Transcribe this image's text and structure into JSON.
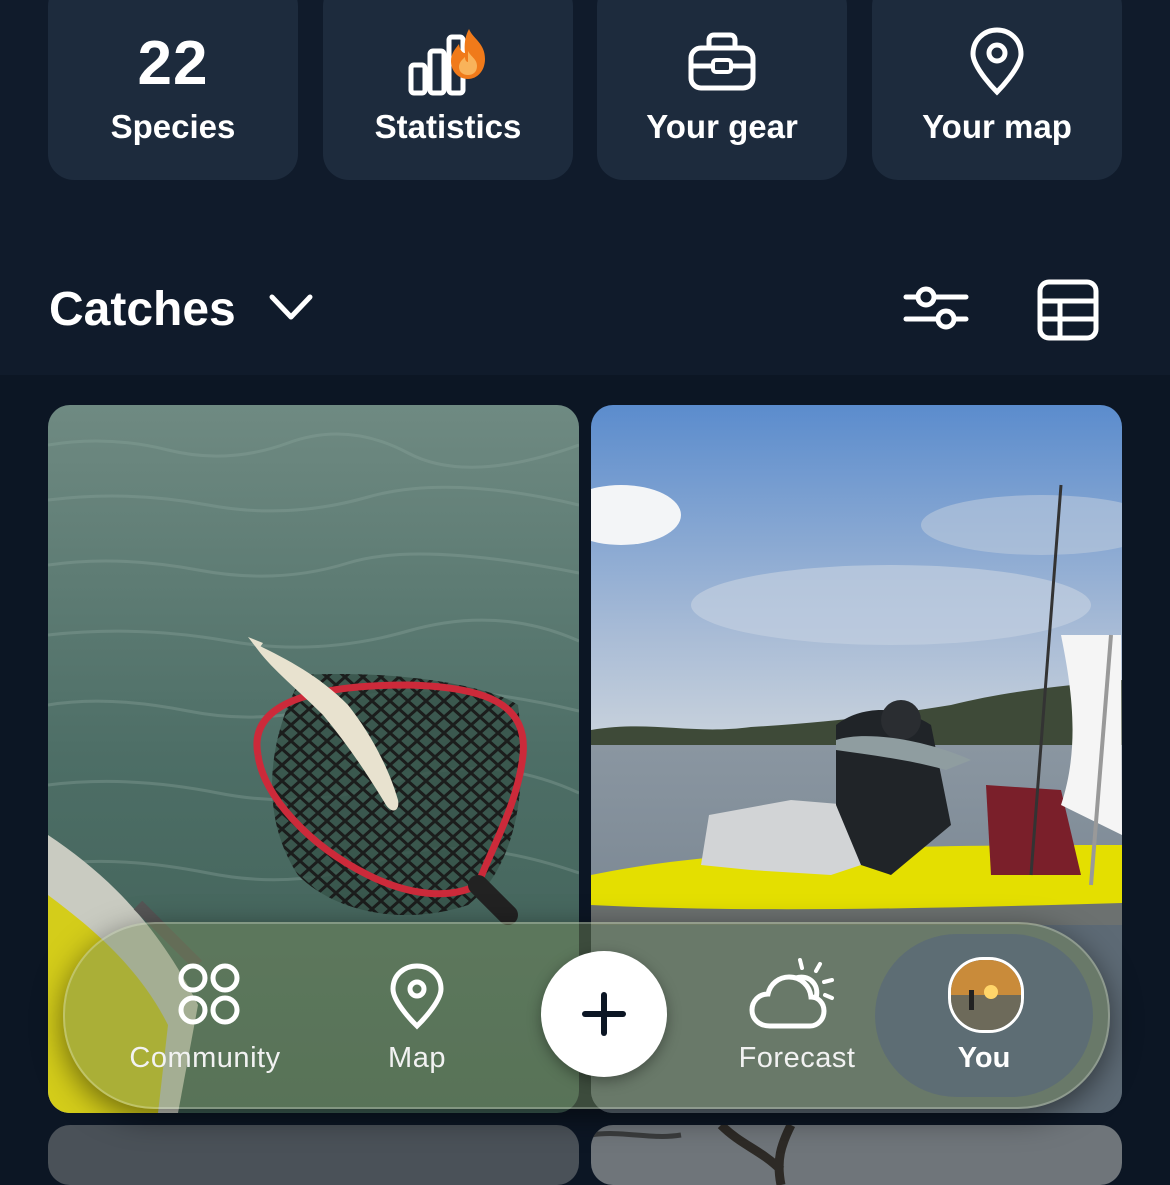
{
  "stats": [
    {
      "value": "22",
      "label": "Species"
    },
    {
      "label": "Statistics",
      "icon": "bar-chart-flame-icon"
    },
    {
      "label": "Your gear",
      "icon": "tackle-box-icon"
    },
    {
      "label": "Your map",
      "icon": "map-pin-icon"
    }
  ],
  "catches": {
    "title": "Catches"
  },
  "nav": {
    "community": "Community",
    "map": "Map",
    "forecast": "Forecast",
    "you": "You",
    "add_icon": "plus-icon"
  },
  "colors": {
    "background": "#0c1624",
    "card": "#1d2b3d",
    "flame": "#f07a1a",
    "kayak": "#e8e400",
    "net_rim": "#d8283a"
  }
}
